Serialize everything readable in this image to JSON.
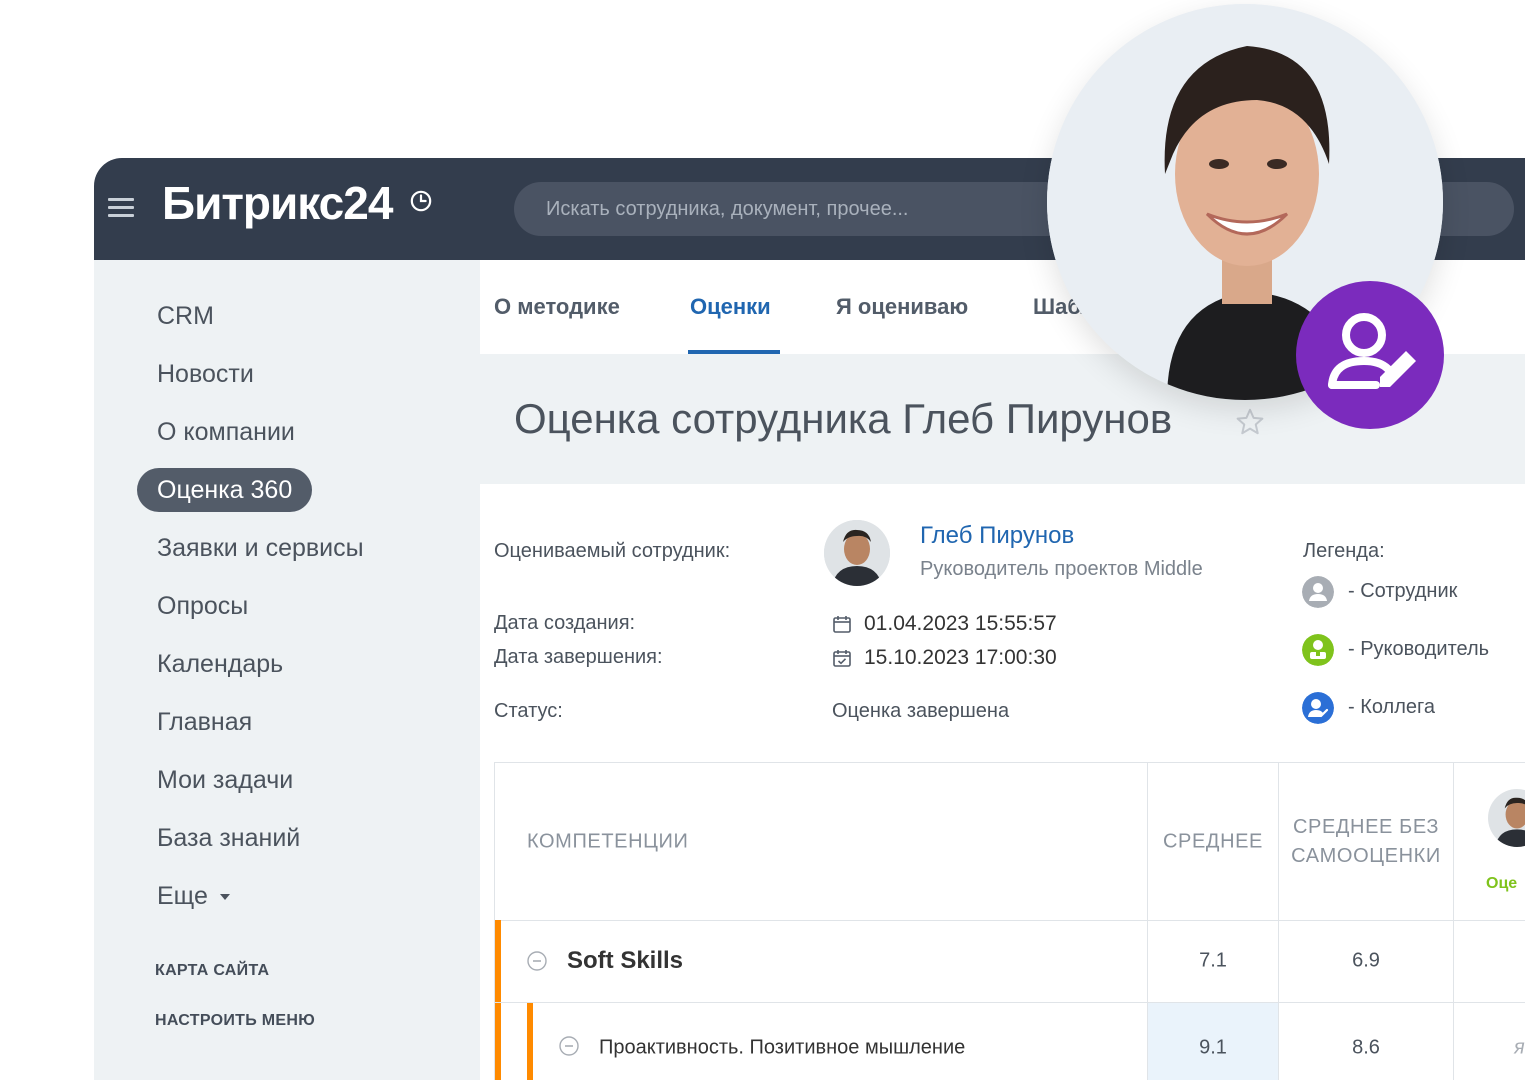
{
  "app": {
    "logo_text": "Битрикс24",
    "search_placeholder": "Искать сотрудника, документ, прочее..."
  },
  "sidebar": {
    "items": [
      {
        "label": "CRM"
      },
      {
        "label": "Новости"
      },
      {
        "label": "О компании"
      },
      {
        "label": "Оценка 360",
        "active": true
      },
      {
        "label": "Заявки и сервисы"
      },
      {
        "label": "Опросы"
      },
      {
        "label": "Календарь"
      },
      {
        "label": "Главная"
      },
      {
        "label": "Мои задачи"
      },
      {
        "label": "База знаний"
      },
      {
        "label": "Еще"
      }
    ],
    "sitemap": "КАРТА САЙТА",
    "configure_menu": "НАСТРОИТЬ МЕНЮ"
  },
  "tabs": [
    {
      "label": "О методике"
    },
    {
      "label": "Оценки",
      "active": true
    },
    {
      "label": "Я оцениваю"
    },
    {
      "label": "Шаблоны"
    }
  ],
  "page_title": "Оценка сотрудника Глеб Пирунов",
  "details": {
    "employee_label": "Оцениваемый сотрудник:",
    "employee_name": "Глеб Пирунов",
    "employee_role": "Руководитель проектов Middle",
    "created_label": "Дата создания:",
    "created_value": "01.04.2023 15:55:57",
    "finished_label": "Дата завершения:",
    "finished_value": "15.10.2023 17:00:30",
    "status_label": "Статус:",
    "status_value": "Оценка завершена"
  },
  "legend": {
    "title": "Легенда:",
    "items": [
      {
        "label": "- Сотрудник",
        "color": "#a8adb4"
      },
      {
        "label": "- Руководитель",
        "color": "#7fc31c"
      },
      {
        "label": "- Коллега",
        "color": "#2b6fd6"
      }
    ]
  },
  "table": {
    "headers": {
      "competencies": "КОМПЕТЕНЦИИ",
      "average": "СРЕДНЕЕ",
      "average_no_self": "СРЕДНЕЕ БЕЗ САМООЦЕНКИ",
      "assessor_status": "Оце"
    },
    "rows": [
      {
        "name": "Soft Skills",
        "average": "7.1",
        "average_no_self": "6.9",
        "level": 0
      },
      {
        "name": "Проактивность. Позитивное мышление",
        "average": "9.1",
        "average_no_self": "8.6",
        "extra": "я",
        "level": 1
      }
    ]
  },
  "colors": {
    "topbar": "#333d4d",
    "accent_blue": "#2066b0",
    "badge_purple": "#7b2bbd",
    "category_marker": "#ff8a00",
    "highlight_cell": "#eaf3fb"
  }
}
